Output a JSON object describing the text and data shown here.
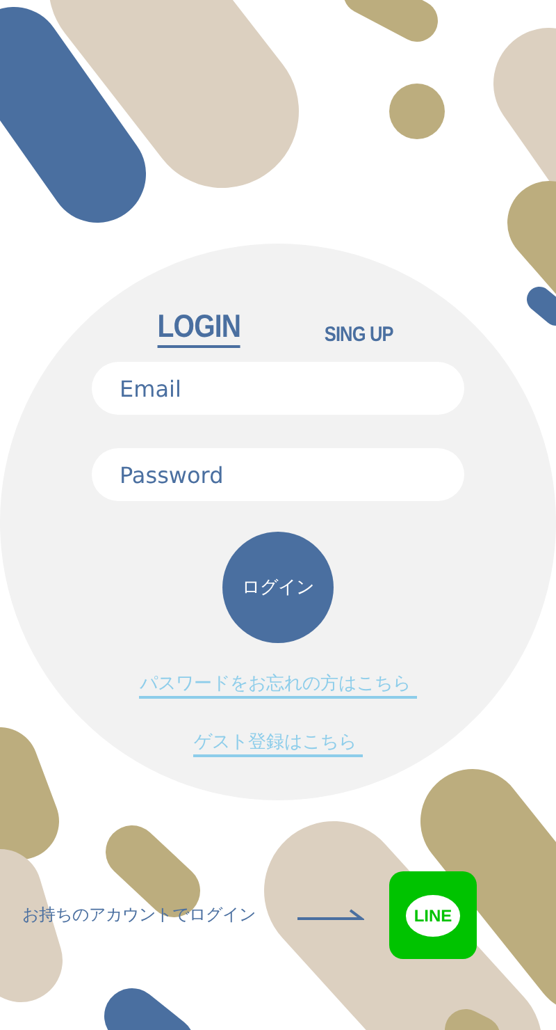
{
  "tabs": [
    {
      "label": "LOGIN",
      "selected": true
    },
    {
      "label": "SING UP",
      "selected": false
    }
  ],
  "fields": [
    {
      "placeholder": "Email"
    },
    {
      "placeholder": "Password"
    }
  ],
  "login_button": "ログイン",
  "links": [
    "パスワードをお忘れの方はこちら ",
    "ゲスト登録はこちら "
  ],
  "social_login": {
    "text": "お持ちのアカウントでログイン",
    "logo_text": "LINE"
  }
}
